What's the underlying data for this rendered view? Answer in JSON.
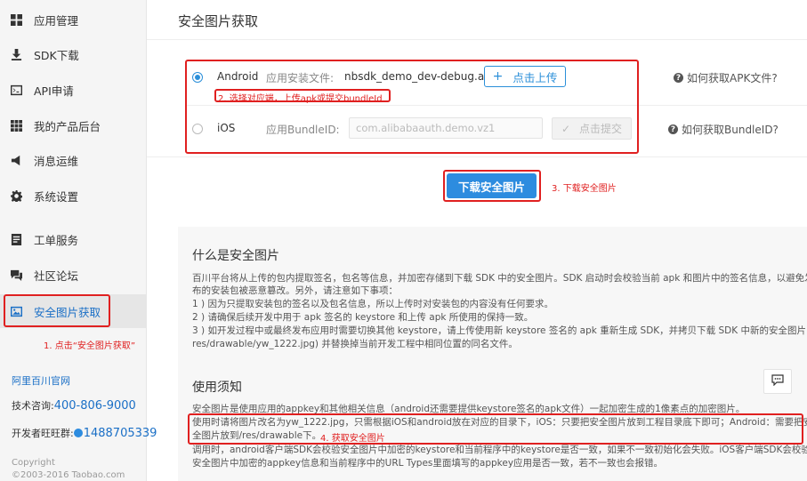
{
  "sidebar": {
    "items": [
      {
        "label": "应用管理",
        "icon": "apps-icon"
      },
      {
        "label": "SDK下载",
        "icon": "download-icon"
      },
      {
        "label": "API申请",
        "icon": "terminal-icon"
      },
      {
        "label": "我的产品后台",
        "icon": "grid-icon"
      },
      {
        "label": "消息运维",
        "icon": "megaphone-icon"
      },
      {
        "label": "系统设置",
        "icon": "gear-icon"
      },
      {
        "label": "工单服务",
        "icon": "ticket-icon"
      },
      {
        "label": "社区论坛",
        "icon": "chat-icon"
      },
      {
        "label": "安全图片获取",
        "icon": "image-icon",
        "active": true
      }
    ],
    "annotation": "1. 点击“安全图片获取”",
    "official_site": "阿里百川官网",
    "tech_label": "技术咨询:",
    "tech_phone": "400-806-9000",
    "wangwang_label": "开发者旺旺群:",
    "wangwang_number": "1488705339",
    "copyright_line1": "Copyright",
    "copyright_line2": "©2003-2016 Taobao.com"
  },
  "main": {
    "title": "安全图片获取",
    "android": {
      "label": "Android",
      "file_label": "应用安装文件:",
      "file_name": "nbsdk_demo_dev-debug.apk",
      "upload_button": "点击上传",
      "annotation": "2. 选择对应端，上传apk或提交bundleId",
      "help": "如何获取APK文件?",
      "selected": true
    },
    "ios": {
      "label": "iOS",
      "bundle_label": "应用BundleID:",
      "bundle_placeholder": "com.alibabaauth.demo.vz1",
      "submit_button": "点击提交",
      "help": "如何获取BundleID?",
      "selected": false
    },
    "download_button": "下载安全图片",
    "download_annotation": "3. 下载安全图片"
  },
  "info": {
    "what_title": "什么是安全图片",
    "what_lines": [
      "百川平台将从上传的包内提取签名，包名等信息，并加密存储到下载 SDK 中的安全图片。SDK 启动时会校验当前 apk 和图片中的签名信息，以避免发",
      "布的安装包被恶意篡改。另外，请注意如下事项：",
      "1 ) 因为只提取安装包的签名以及包名信息，所以上传时对安装包的内容没有任何要求。",
      "2 ) 请确保后续开发中用于 apk 签名的 keystore 和上传 apk 所使用的保持一致。",
      "3 ) 如开发过程中或最终发布应用时需要切换其他 keystore，请上传使用新 keystore 签名的 apk 重新生成 SDK，并拷贝下载 SDK 中新的安全图片 (",
      "res/drawable/yw_1222.jpg) 并替换掉当前开发工程中相同位置的同名文件。"
    ],
    "usage_title": "使用须知",
    "usage_lines": [
      "安全图片是使用应用的appkey和其他相关信息（android还需要提供keystore签名的apk文件）一起加密生成的1像素点的加密图片。",
      "使用时请将图片改名为yw_1222.jpg，只需根据iOS和android放在对应的目录下，iOS：只要把安全图片放到工程目录底下即可；Android：需要把安",
      "全图片放到/res/drawable下。",
      "调用时，android客户端SDK会校验安全图片中加密的keystore和当前程序中的keystore是否一致，如果不一致初始化会失败。iOS客户端SDK会校验",
      "安全图片中加密的appkey信息和当前程序中的URL Types里面填写的appkey应用是否一致，若不一致也会报错。"
    ],
    "usage_annotation": "4. 获取安全图片"
  },
  "colors": {
    "accent": "#2d8cdf",
    "annotation_red": "#e02020",
    "sidebar_bg": "#f5f5f5"
  }
}
